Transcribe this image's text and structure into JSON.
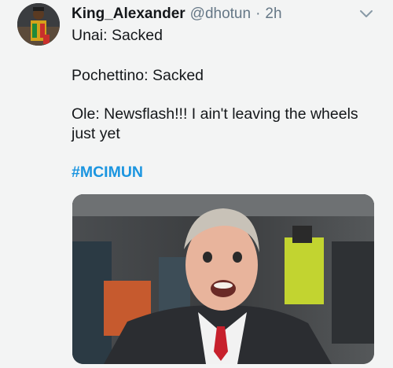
{
  "tweet": {
    "author_name": "King_Alexander",
    "handle": "@dhotun",
    "separator": "·",
    "time": "2h",
    "lines": [
      "Unai: Sacked",
      "Pochettino: Sacked",
      "Ole: Newsflash!!! I ain't leaving the wheels",
      "just yet"
    ],
    "hashtag": "#MCIMUN",
    "icons": {
      "menu": "chevron-down-icon"
    },
    "colors": {
      "background": "#f3f4f4",
      "text": "#14171a",
      "muted": "#657786",
      "link": "#1b95e0"
    }
  }
}
